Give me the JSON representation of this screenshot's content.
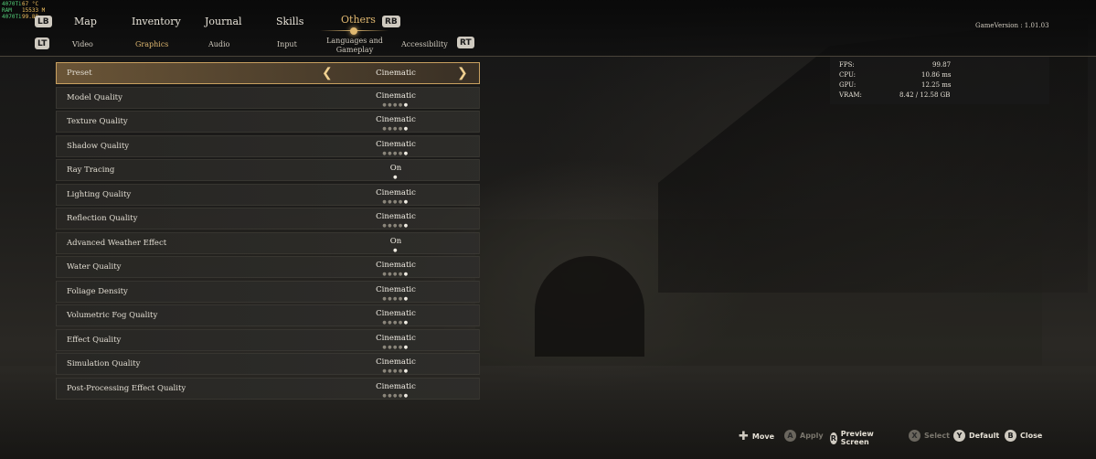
{
  "perf_overlay": [
    {
      "k": "4070Ti",
      "v": "67 °C"
    },
    {
      "k": "RAM",
      "v": "15533 M"
    },
    {
      "k": "4070Ti",
      "v": "99.89"
    }
  ],
  "pads": {
    "lb": "LB",
    "rb": "RB",
    "lt": "LT",
    "rt": "RT"
  },
  "main_tabs": [
    "Map",
    "Inventory",
    "Journal",
    "Skills",
    "Others"
  ],
  "sub_tabs": [
    "Video",
    "Graphics",
    "Audio",
    "Input",
    "Languages and Gameplay",
    "Accessibility"
  ],
  "game_version": "GameVersion : 1.01.03",
  "settings": [
    {
      "label": "Preset",
      "value": "Cinematic"
    },
    {
      "label": "Model Quality",
      "value": "Cinematic"
    },
    {
      "label": "Texture Quality",
      "value": "Cinematic"
    },
    {
      "label": "Shadow Quality",
      "value": "Cinematic"
    },
    {
      "label": "Ray Tracing",
      "value": "On"
    },
    {
      "label": "Lighting Quality",
      "value": "Cinematic"
    },
    {
      "label": "Reflection Quality",
      "value": "Cinematic"
    },
    {
      "label": "Advanced Weather Effect",
      "value": "On"
    },
    {
      "label": "Water Quality",
      "value": "Cinematic"
    },
    {
      "label": "Foliage Density",
      "value": "Cinematic"
    },
    {
      "label": "Volumetric Fog Quality",
      "value": "Cinematic"
    },
    {
      "label": "Effect Quality",
      "value": "Cinematic"
    },
    {
      "label": "Simulation Quality",
      "value": "Cinematic"
    },
    {
      "label": "Post-Processing Effect Quality",
      "value": "Cinematic"
    }
  ],
  "stats": {
    "fps_label": "FPS:",
    "fps": "99.87",
    "cpu_label": "CPU:",
    "cpu": "10.86 ms",
    "gpu_label": "GPU:",
    "gpu": "12.25 ms",
    "vram_label": "VRAM:",
    "vram": "8.42 / 12.58 GB"
  },
  "footer": {
    "move": "Move",
    "a": "A",
    "apply": "Apply",
    "r": "R",
    "preview": "Preview Screen",
    "x": "X",
    "select": "Select",
    "y": "Y",
    "default": "Default",
    "b": "B",
    "close": "Close"
  },
  "colors": {
    "accent": "#e0b870",
    "selected_border": "#c8a060"
  }
}
